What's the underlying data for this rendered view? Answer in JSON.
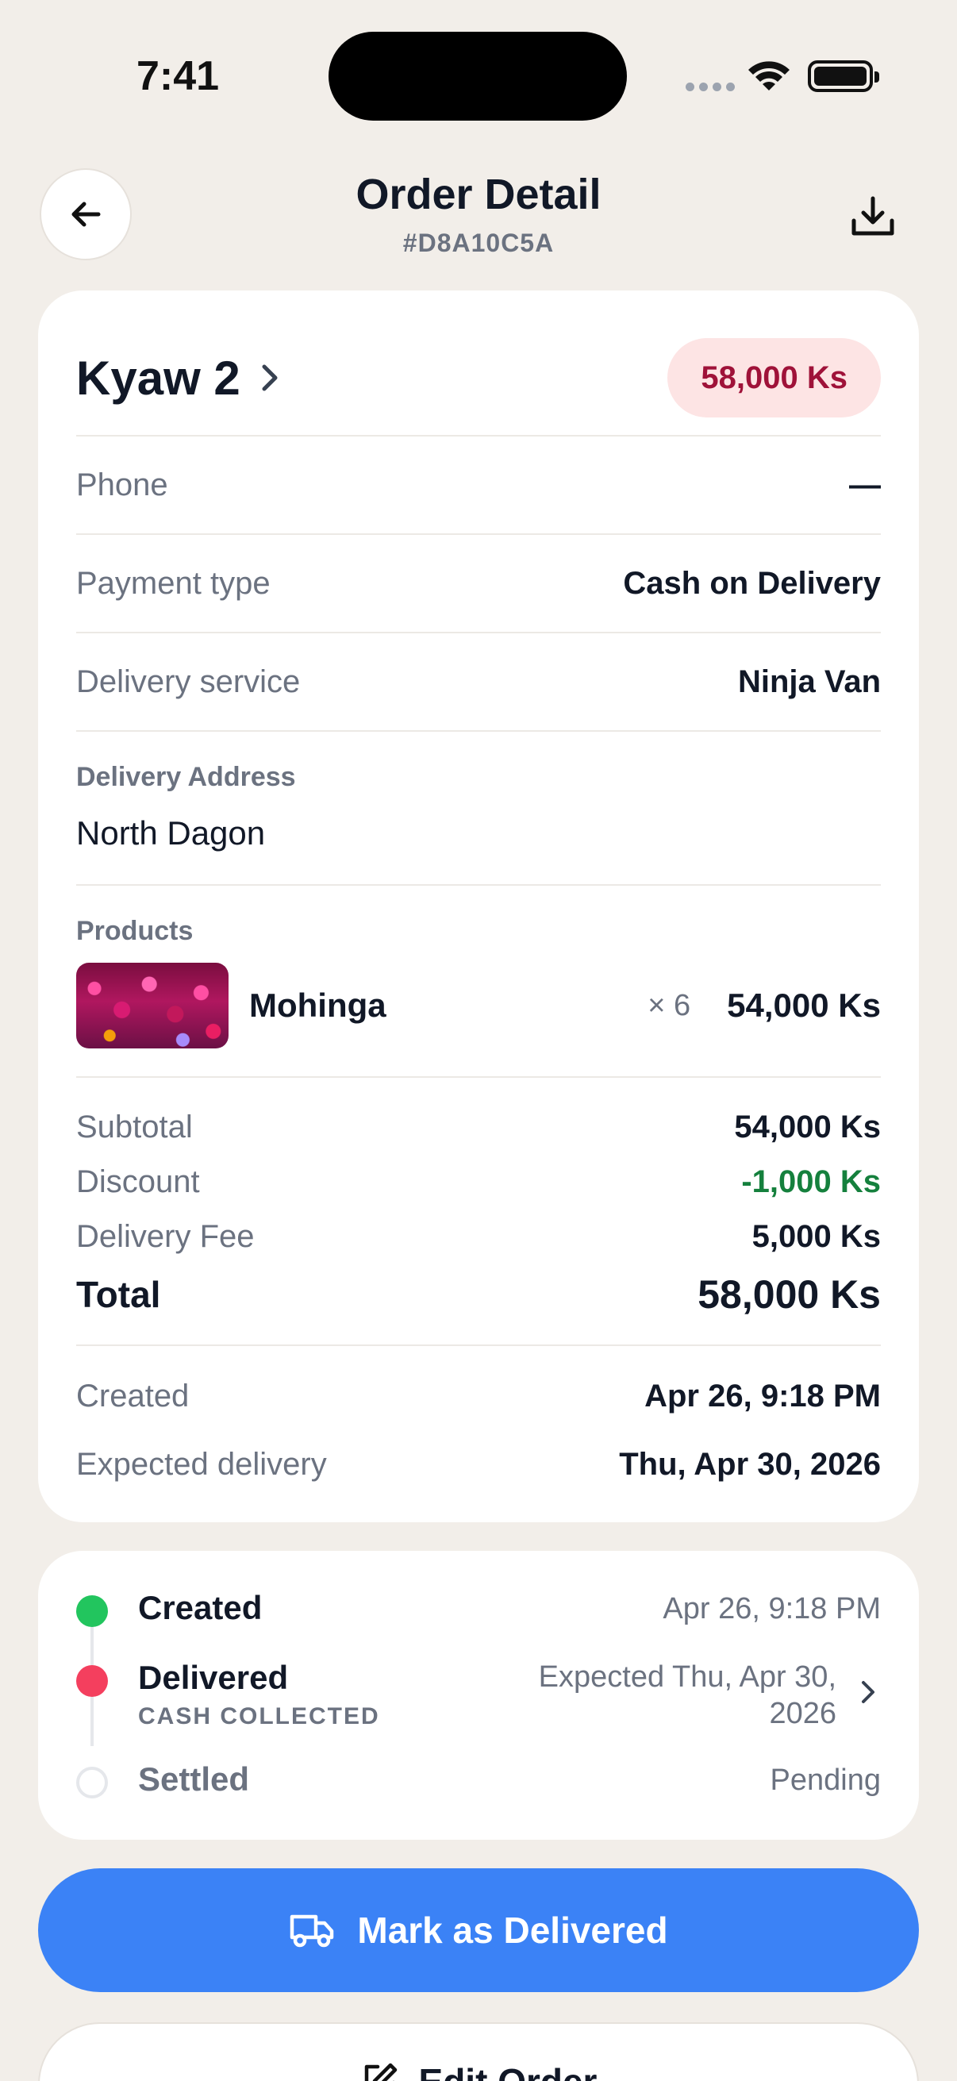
{
  "status_bar": {
    "time": "7:41"
  },
  "header": {
    "title": "Order Detail",
    "order_id": "#D8A10C5A"
  },
  "customer": {
    "name": "Kyaw 2",
    "total_badge": "58,000 Ks"
  },
  "details": [
    {
      "label": "Phone",
      "value": "—"
    },
    {
      "label": "Payment type",
      "value": "Cash on Delivery"
    },
    {
      "label": "Delivery service",
      "value": "Ninja Van"
    }
  ],
  "address": {
    "label": "Delivery Address",
    "value": "North Dagon"
  },
  "products": {
    "label": "Products",
    "items": [
      {
        "name": "Mohinga",
        "qty": "× 6",
        "price": "54,000 Ks"
      }
    ]
  },
  "summary": {
    "subtotal_label": "Subtotal",
    "subtotal": "54,000 Ks",
    "discount_label": "Discount",
    "discount": "-1,000 Ks",
    "fee_label": "Delivery Fee",
    "fee": "5,000 Ks",
    "total_label": "Total",
    "total": "58,000 Ks"
  },
  "dates": {
    "created_label": "Created",
    "created": "Apr 26, 9:18 PM",
    "expected_label": "Expected delivery",
    "expected": "Thu, Apr 30, 2026"
  },
  "timeline": [
    {
      "title": "Created",
      "right": "Apr 26, 9:18 PM",
      "color": "#22c55e"
    },
    {
      "title": "Delivered",
      "sub": "CASH COLLECTED",
      "right_line1": "Expected Thu, Apr 30,",
      "right_line2": "2026",
      "color": "#f43f5e"
    },
    {
      "title": "Settled",
      "right": "Pending",
      "color": "#e5e7eb"
    }
  ],
  "actions": {
    "primary": "Mark as Delivered",
    "secondary": "Edit Order"
  },
  "colors": {
    "accent": "#3b82f6",
    "badge_bg": "#fde4e4",
    "badge_text": "#9f1239",
    "discount": "#15803d",
    "background": "#f2eee9"
  }
}
